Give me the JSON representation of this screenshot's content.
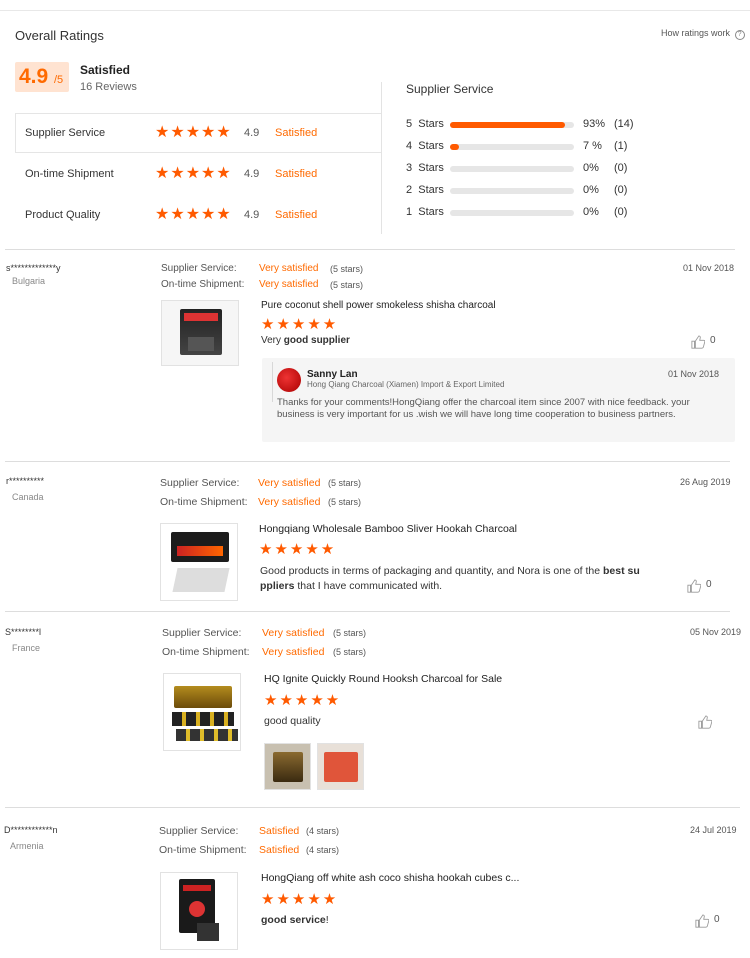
{
  "summary": {
    "title": "Overall Ratings",
    "how_ratings": "How ratings work",
    "score": "4.9",
    "score_suffix": "/5",
    "satisfaction": "Satisfied",
    "reviews": "16 Reviews",
    "categories": [
      {
        "label": "Supplier Service",
        "score": "4.9",
        "status": "Satisfied"
      },
      {
        "label": "On-time Shipment",
        "score": "4.9",
        "status": "Satisfied"
      },
      {
        "label": "Product Quality",
        "score": "4.9",
        "status": "Satisfied"
      }
    ]
  },
  "breakdown": {
    "title": "Supplier Service",
    "rows": [
      {
        "label": "5  Stars",
        "pct": "93%",
        "count": "(14)",
        "fill": 0.93
      },
      {
        "label": "4  Stars",
        "pct": "7 %",
        "count": "(1)",
        "fill": 0.07
      },
      {
        "label": "3  Stars",
        "pct": "0%",
        "count": "(0)",
        "fill": 0
      },
      {
        "label": "2  Stars",
        "pct": "0%",
        "count": "(0)",
        "fill": 0
      },
      {
        "label": "1  Stars",
        "pct": "0%",
        "count": "(0)",
        "fill": 0
      }
    ]
  },
  "reviews": [
    {
      "user": "s*************y",
      "country": "Bulgaria",
      "service_label": "Supplier Service:",
      "service_status": "Very satisfied",
      "service_stars": "(5 stars)",
      "shipment_label": "On-time Shipment:",
      "shipment_status": "Very satisfied",
      "shipment_stars": "(5 stars)",
      "date": "01 Nov 2018",
      "product": "Pure coconut shell power smokeless shisha charcoal",
      "comment_pre": "Very ",
      "comment_bold": "good supplier",
      "comment_post": "",
      "likes": "0",
      "reply": {
        "name": "Sanny Lan",
        "company": "Hong Qiang Charcoal (Xiamen) Import & Export Limited",
        "date": "01 Nov 2018",
        "text": "Thanks for your comments!HongQiang offer the charcoal item since 2007 with nice feedback. your business is very important for us .wish we will have long time cooperation to business partners."
      }
    },
    {
      "user": "r**********",
      "country": "Canada",
      "service_label": "Supplier Service:",
      "service_status": "Very satisfied",
      "service_stars": "(5 stars)",
      "shipment_label": "On-time Shipment:",
      "shipment_status": "Very satisfied",
      "shipment_stars": "(5 stars)",
      "date": "26 Aug 2019",
      "product": "Hongqiang Wholesale Bamboo Sliver Hookah Charcoal",
      "comment_pre": "Good products in terms of packaging and quantity, and Nora is one of the ",
      "comment_bold": "best su",
      "comment_line2_bold": "ppliers",
      "comment_post": " that I have communicated with.",
      "likes": "0"
    },
    {
      "user": "S********l",
      "country": "France",
      "service_label": "Supplier Service:",
      "service_status": "Very satisfied",
      "service_stars": "(5 stars)",
      "shipment_label": "On-time Shipment:",
      "shipment_status": "Very satisfied",
      "shipment_stars": "(5 stars)",
      "date": "05 Nov 2019",
      "product": "HQ Ignite Quickly Round Hooksh Charcoal for Sale",
      "comment_pre": "good quality",
      "comment_bold": "",
      "comment_post": "",
      "likes": ""
    },
    {
      "user": "D************n",
      "country": "Armenia",
      "service_label": "Supplier Service:",
      "service_status": "Satisfied",
      "service_stars": "(4 stars)",
      "shipment_label": "On-time Shipment:",
      "shipment_status": "Satisfied",
      "shipment_stars": "(4 stars)",
      "date": "24 Jul 2019",
      "product": "HongQiang off white ash coco shisha hookah cubes c...",
      "comment_pre": "",
      "comment_bold": "good service",
      "comment_post": "!",
      "likes": "0"
    }
  ],
  "stars_glyph": "★★★★★",
  "accent_color": "#ff5a00"
}
